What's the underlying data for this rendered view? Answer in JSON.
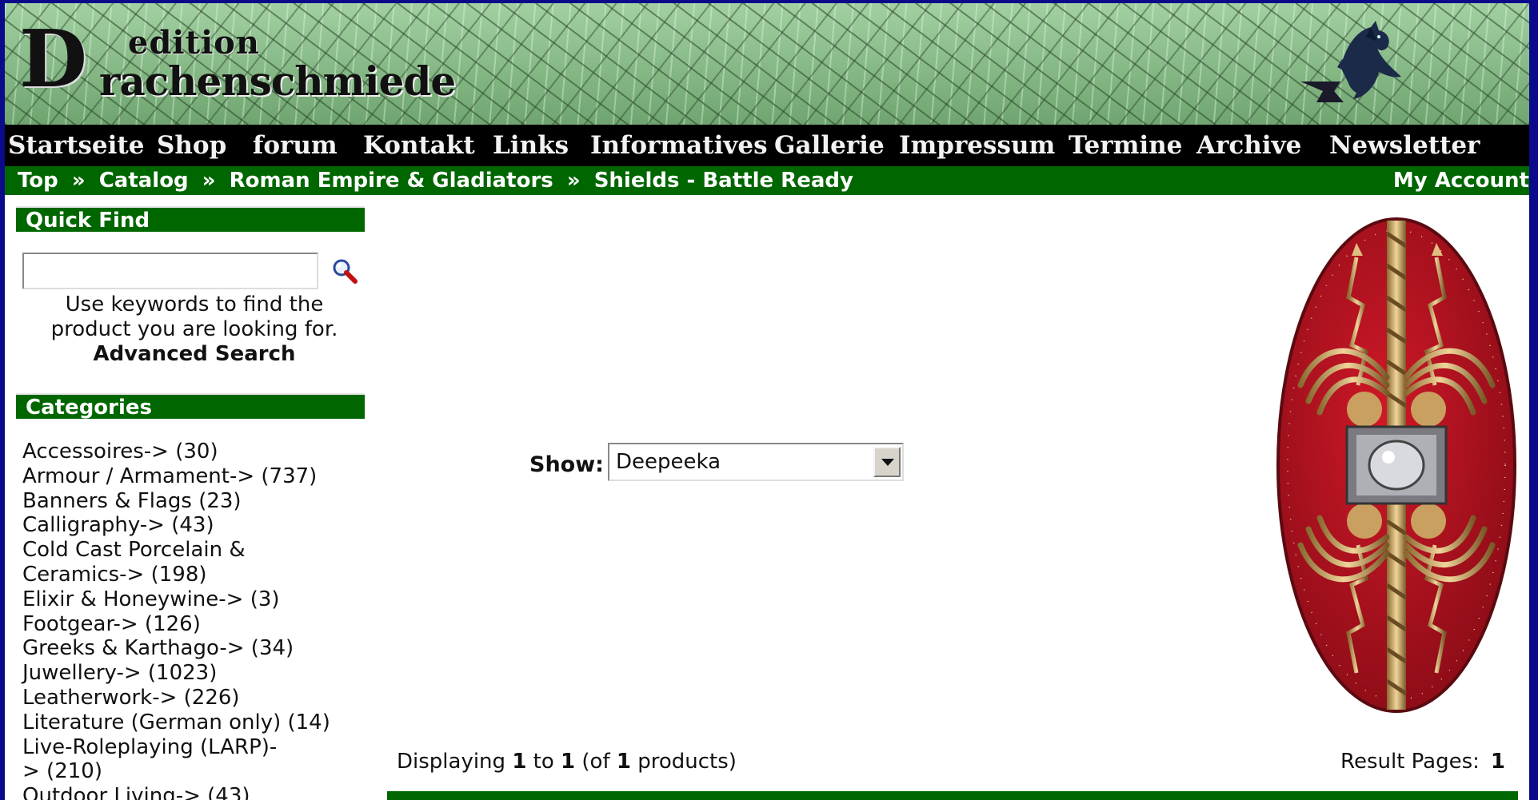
{
  "header": {
    "logo_small": "edition",
    "logo_big_letter": "D",
    "logo_rest": "rachenschmiede",
    "dragon_icon": "dragon-anvil-icon"
  },
  "nav": {
    "items": [
      {
        "label": "Startseite"
      },
      {
        "label": "Shop"
      },
      {
        "label": "forum"
      },
      {
        "label": "Kontakt"
      },
      {
        "label": "Links"
      },
      {
        "label": "Informatives"
      },
      {
        "label": "Gallerie"
      },
      {
        "label": "Impressum"
      },
      {
        "label": "Termine"
      },
      {
        "label": "Archive"
      },
      {
        "label": "Newsletter"
      }
    ]
  },
  "breadcrumb": {
    "items": [
      "Top",
      "Catalog",
      "Roman Empire & Gladiators",
      "Shields - Battle Ready"
    ],
    "separator": "»",
    "my_account": "My Account"
  },
  "quick_find": {
    "heading": "Quick Find",
    "input_value": "",
    "search_icon": "magnifier-icon",
    "help_text": "Use keywords to find the product you are looking for.",
    "advanced_link": "Advanced Search"
  },
  "categories": {
    "heading": "Categories",
    "items": [
      "Accessoires-> (30)",
      "Armour / Armament-> (737)",
      "Banners & Flags (23)",
      "Calligraphy-> (43)",
      "Cold Cast Porcelain &\nCeramics-> (198)",
      "Elixir & Honeywine-> (3)",
      "Footgear-> (126)",
      "Greeks & Karthago-> (34)",
      "Juwellery-> (1023)",
      "Leatherwork-> (226)",
      "Literature (German only) (14)",
      "Live-Roleplaying (LARP)-\n> (210)",
      "Outdoor Living-> (43)"
    ]
  },
  "main": {
    "show_label": "Show:",
    "show_value": "Deepeeka",
    "product_image_icon": "roman-shield-image",
    "displaying_pre": "Displaying ",
    "displaying_from": "1",
    "displaying_to_word": " to ",
    "displaying_to": "1",
    "displaying_of_word": " (of ",
    "displaying_total": "1",
    "displaying_post": " products)",
    "result_pages_label": "Result Pages:",
    "result_pages_value": "1"
  },
  "colors": {
    "frame_bg": "#0a0a8a",
    "bar_green": "#006600",
    "nav_black": "#000000",
    "shield_red": "#b01020",
    "shield_gold": "#c8a060"
  }
}
